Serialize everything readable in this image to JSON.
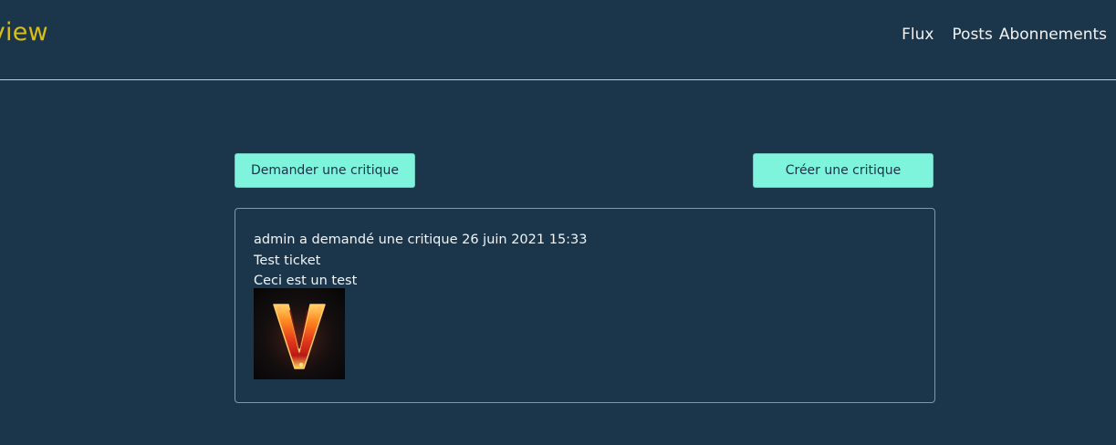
{
  "header": {
    "brand": "eview",
    "nav": {
      "flux": "Flux",
      "posts": "Posts",
      "abonnements": "Abonnements"
    }
  },
  "actions": {
    "request_review": "Demander une critique",
    "create_review": "Créer une critique"
  },
  "ticket": {
    "meta": "admin a demandé une critique 26 juin 2021 15:33",
    "title": "Test ticket",
    "description": "Ceci est un test"
  },
  "colors": {
    "background": "#1b354b",
    "accent": "#7ff4dc",
    "brand": "#d9bf16",
    "divider": "#8ee6dd"
  }
}
